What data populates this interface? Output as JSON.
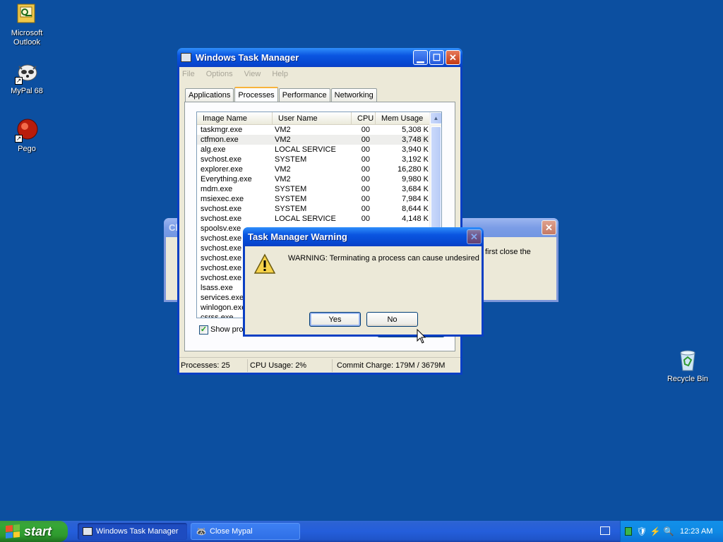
{
  "desktop": {
    "icons": [
      {
        "label": "Microsoft Outlook",
        "icon": "outlook-icon"
      },
      {
        "label": "MyPal 68",
        "icon": "mypal-icon"
      },
      {
        "label": "Pego",
        "icon": "pego-icon"
      },
      {
        "label": "Recycle Bin",
        "icon": "recycle-bin-icon"
      }
    ]
  },
  "task_manager": {
    "title": "Windows Task Manager",
    "menu": [
      "File",
      "Options",
      "View",
      "Help"
    ],
    "tabs": [
      "Applications",
      "Processes",
      "Performance",
      "Networking"
    ],
    "active_tab": "Processes",
    "columns": [
      "Image Name",
      "User Name",
      "CPU",
      "Mem Usage"
    ],
    "rows": [
      [
        "taskmgr.exe",
        "VM2",
        "00",
        "5,308 K"
      ],
      [
        "ctfmon.exe",
        "VM2",
        "00",
        "3,748 K"
      ],
      [
        "alg.exe",
        "LOCAL SERVICE",
        "00",
        "3,940 K"
      ],
      [
        "svchost.exe",
        "SYSTEM",
        "00",
        "3,192 K"
      ],
      [
        "explorer.exe",
        "VM2",
        "00",
        "16,280 K"
      ],
      [
        "Everything.exe",
        "VM2",
        "00",
        "9,980 K"
      ],
      [
        "mdm.exe",
        "SYSTEM",
        "00",
        "3,684 K"
      ],
      [
        "msiexec.exe",
        "SYSTEM",
        "00",
        "7,984 K"
      ],
      [
        "svchost.exe",
        "SYSTEM",
        "00",
        "8,644 K"
      ],
      [
        "svchost.exe",
        "LOCAL SERVICE",
        "00",
        "4,148 K"
      ],
      [
        "spoolsv.exe",
        "",
        "",
        ""
      ],
      [
        "svchost.exe",
        "",
        "",
        ""
      ],
      [
        "svchost.exe",
        "",
        "",
        ""
      ],
      [
        "svchost.exe",
        "",
        "",
        ""
      ],
      [
        "svchost.exe",
        "",
        "",
        ""
      ],
      [
        "svchost.exe",
        "",
        "",
        ""
      ],
      [
        "lsass.exe",
        "",
        "",
        ""
      ],
      [
        "services.exe",
        "",
        "",
        ""
      ],
      [
        "winlogon.exe",
        "",
        "",
        ""
      ],
      [
        "csrss.exe",
        "",
        "",
        ""
      ]
    ],
    "show_processes_label": "Show proc",
    "status": {
      "processes": "Processes: 25",
      "cpu": "CPU Usage: 2%",
      "commit": "Commit Charge: 179M / 3679M"
    }
  },
  "background_dialog": {
    "title": "Cl",
    "text": "first close the"
  },
  "warning_dialog": {
    "title": "Task Manager Warning",
    "message": "WARNING: Terminating a process can cause undesired",
    "yes_label": "Yes",
    "no_label": "No"
  },
  "taskbar": {
    "start_label": "start",
    "items": [
      {
        "label": "Windows Task Manager",
        "active": true
      },
      {
        "label": "Close Mypal",
        "active": false
      }
    ],
    "clock": "12:23 AM"
  },
  "colors": {
    "desktop": "#0c4fa0",
    "titlebar_active": "#0a55e0",
    "window_face": "#ece9d8"
  }
}
